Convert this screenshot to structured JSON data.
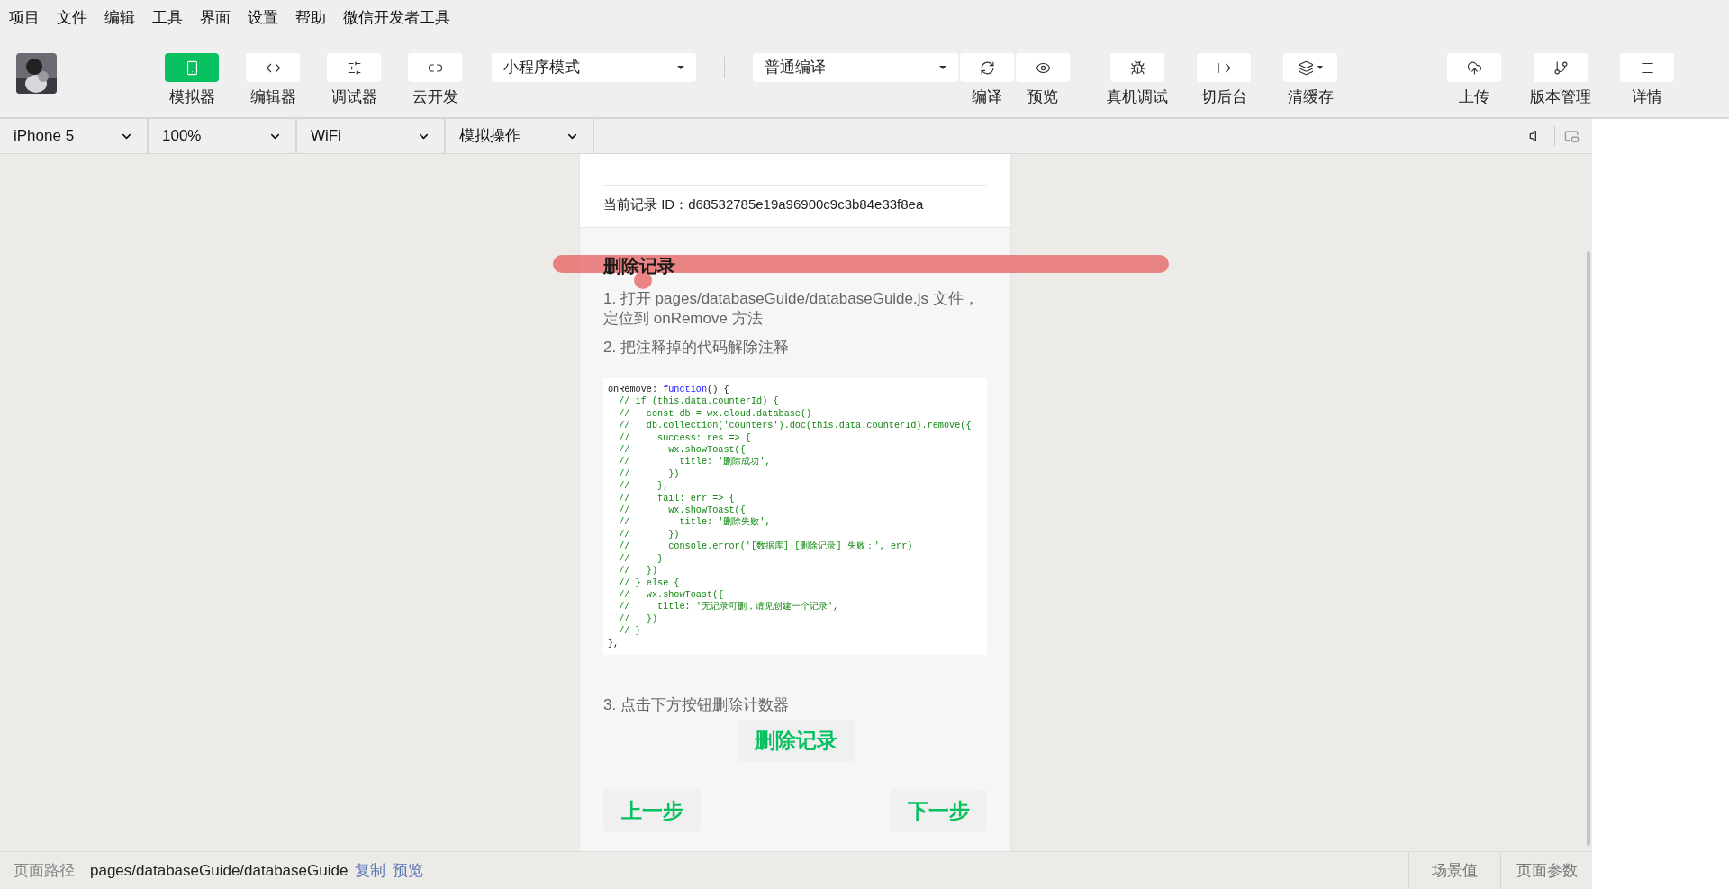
{
  "menu_bar": [
    "项目",
    "文件",
    "编辑",
    "工具",
    "界面",
    "设置",
    "帮助",
    "微信开发者工具"
  ],
  "toolbar": {
    "left_tools": [
      {
        "label": "模拟器",
        "selected": true
      },
      {
        "label": "编辑器",
        "selected": false
      },
      {
        "label": "调试器",
        "selected": false
      },
      {
        "label": "云开发",
        "selected": false
      }
    ],
    "mode_select": "小程序模式",
    "compile_select": "普通编译",
    "compile_tools": [
      {
        "label": "编译"
      },
      {
        "label": "预览"
      }
    ],
    "middle_tools": [
      {
        "label": "真机调试",
        "dropdown": false
      },
      {
        "label": "切后台",
        "dropdown": false
      },
      {
        "label": "清缓存",
        "dropdown": true
      }
    ],
    "right_tools": [
      {
        "label": "上传"
      },
      {
        "label": "版本管理"
      },
      {
        "label": "详情"
      }
    ]
  },
  "device_bar": [
    "iPhone 5",
    "100%",
    "WiFi",
    "模拟操作"
  ],
  "phone": {
    "record_id": "当前记录 ID：d68532785e19a96900c9c3b84e33f8ea",
    "heading": "删除记录",
    "steps": [
      "1. 打开 pages/databaseGuide/databaseGuide.js 文件，定位到 onRemove 方法",
      "2. 把注释掉的代码解除注释"
    ],
    "code": [
      [
        {
          "text": "onRemove: ",
          "kind": "plain"
        },
        {
          "text": "function",
          "kind": "keyword"
        },
        {
          "text": "() {",
          "kind": "plain"
        }
      ],
      [
        {
          "text": "  // if (this.data.counterId) {",
          "kind": "comment"
        }
      ],
      [
        {
          "text": "  //   const db = wx.cloud.database()",
          "kind": "comment"
        }
      ],
      [
        {
          "text": "  //   db.collection('counters').doc(this.data.counterId).remove({",
          "kind": "comment"
        }
      ],
      [
        {
          "text": "  //     success: res => {",
          "kind": "comment"
        }
      ],
      [
        {
          "text": "  //       wx.showToast({",
          "kind": "comment"
        }
      ],
      [
        {
          "text": "  //         title: '删除成功',",
          "kind": "comment"
        }
      ],
      [
        {
          "text": "  //       })",
          "kind": "comment"
        }
      ],
      [
        {
          "text": "  //     },",
          "kind": "comment"
        }
      ],
      [
        {
          "text": "  //     fail: err => {",
          "kind": "comment"
        }
      ],
      [
        {
          "text": "  //       wx.showToast({",
          "kind": "comment"
        }
      ],
      [
        {
          "text": "  //         title: '删除失败',",
          "kind": "comment"
        }
      ],
      [
        {
          "text": "  //       })",
          "kind": "comment"
        }
      ],
      [
        {
          "text": "  //       console.error('[数据库] [删除记录] 失败：', err)",
          "kind": "comment"
        }
      ],
      [
        {
          "text": "  //     }",
          "kind": "comment"
        }
      ],
      [
        {
          "text": "  //   })",
          "kind": "comment"
        }
      ],
      [
        {
          "text": "  // } else {",
          "kind": "comment"
        }
      ],
      [
        {
          "text": "  //   wx.showToast({",
          "kind": "comment"
        }
      ],
      [
        {
          "text": "  //     title: '无记录可删，请见创建一个记录',",
          "kind": "comment"
        }
      ],
      [
        {
          "text": "  //   })",
          "kind": "comment"
        }
      ],
      [
        {
          "text": "  // }",
          "kind": "comment"
        }
      ],
      [
        {
          "text": "},",
          "kind": "plain"
        }
      ]
    ],
    "step_3": "3. 点击下方按钮删除计数器",
    "action_button": "删除记录",
    "prev_button": "上一步",
    "next_button": "下一步"
  },
  "status_bar": {
    "path_label": "页面路径",
    "path": "pages/databaseGuide/databaseGuide",
    "links": [
      "复制",
      "预览"
    ],
    "right_tabs": [
      "场景值",
      "页面参数"
    ]
  }
}
